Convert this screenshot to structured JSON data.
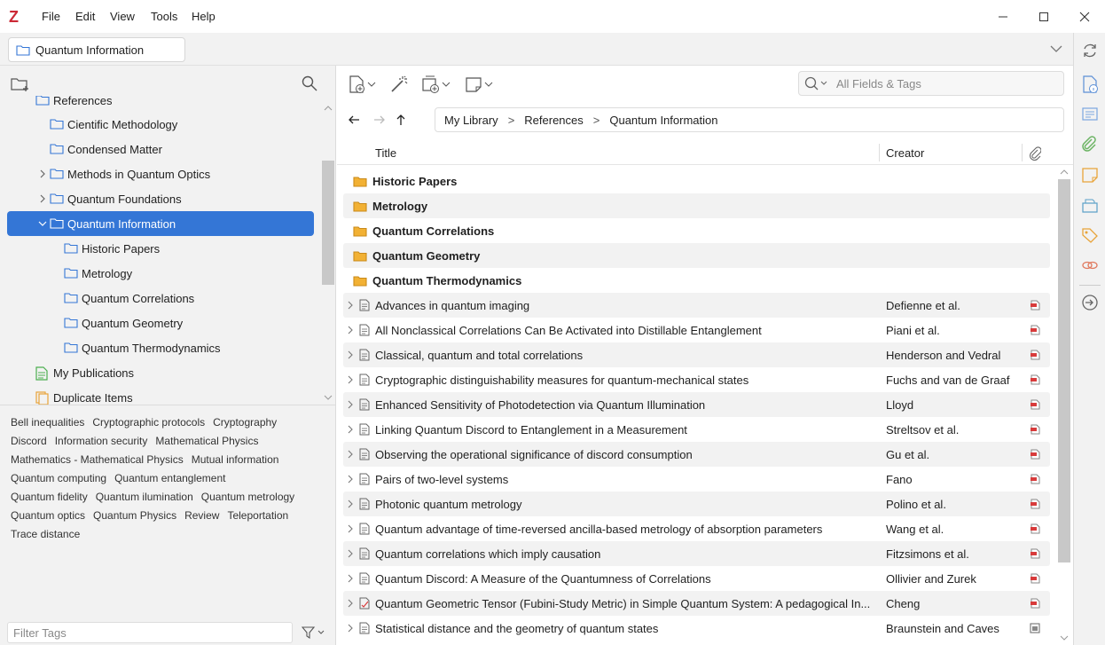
{
  "app": {
    "logo": "Z"
  },
  "menu": [
    "File",
    "Edit",
    "View",
    "Tools",
    "Help"
  ],
  "tab": {
    "label": "Quantum Information"
  },
  "collections": {
    "partial_top": "References",
    "items": [
      {
        "label": "Cientific Methodology",
        "level": 2,
        "expandable": false
      },
      {
        "label": "Condensed Matter",
        "level": 2,
        "expandable": false
      },
      {
        "label": "Methods in Quantum Optics",
        "level": 2,
        "expandable": true
      },
      {
        "label": "Quantum Foundations",
        "level": 2,
        "expandable": true
      },
      {
        "label": "Quantum Information",
        "level": 2,
        "expandable": true,
        "selected": true
      },
      {
        "label": "Historic Papers",
        "level": 3
      },
      {
        "label": "Metrology",
        "level": 3
      },
      {
        "label": "Quantum Correlations",
        "level": 3
      },
      {
        "label": "Quantum Geometry",
        "level": 3
      },
      {
        "label": "Quantum Thermodynamics",
        "level": 3
      },
      {
        "label": "My Publications",
        "level": 1,
        "type": "publications"
      },
      {
        "label": "Duplicate Items",
        "level": 1,
        "type": "duplicates"
      }
    ]
  },
  "tags": {
    "lines": [
      [
        "Bell inequalities",
        "Cryptographic protocols",
        "Cryptography"
      ],
      [
        "Discord",
        "Information security",
        "Mathematical Physics"
      ],
      [
        "Mathematics - Mathematical Physics",
        "Mutual information"
      ],
      [
        "Quantum computing",
        "Quantum entanglement"
      ],
      [
        "Quantum fidelity",
        "Quantum ilumination",
        "Quantum metrology"
      ],
      [
        "Quantum optics",
        "Quantum Physics",
        "Review",
        "Teleportation"
      ],
      [
        "Trace distance"
      ]
    ],
    "filter_placeholder": "Filter Tags"
  },
  "search": {
    "placeholder": "All Fields & Tags"
  },
  "breadcrumb": [
    "My Library",
    "References",
    "Quantum Information"
  ],
  "columns": {
    "title": "Title",
    "creator": "Creator"
  },
  "subcollections": [
    "Historic Papers",
    "Metrology",
    "Quantum Correlations",
    "Quantum Geometry",
    "Quantum Thermodynamics"
  ],
  "items": [
    {
      "title": "Advances in quantum imaging",
      "creator": "Defienne et al.",
      "att": "pdf"
    },
    {
      "title": "All Nonclassical Correlations Can Be Activated into Distillable Entanglement",
      "creator": "Piani et al.",
      "att": "pdf"
    },
    {
      "title": "Classical, quantum and total correlations",
      "creator": "Henderson and Vedral",
      "att": "pdf"
    },
    {
      "title": "Cryptographic distinguishability measures for quantum-mechanical states",
      "creator": "Fuchs and van de Graaf",
      "att": "pdf"
    },
    {
      "title": "Enhanced Sensitivity of Photodetection via Quantum Illumination",
      "creator": "Lloyd",
      "att": "pdf"
    },
    {
      "title": "Linking Quantum Discord to Entanglement in a Measurement",
      "creator": "Streltsov et al.",
      "att": "pdf"
    },
    {
      "title": "Observing the operational significance of discord consumption",
      "creator": "Gu et al.",
      "att": "pdf"
    },
    {
      "title": "Pairs of two-level systems",
      "creator": "Fano",
      "att": "pdf"
    },
    {
      "title": "Photonic quantum metrology",
      "creator": "Polino et al.",
      "att": "pdf"
    },
    {
      "title": "Quantum advantage of time-reversed ancilla-based metrology of absorption parameters",
      "creator": "Wang et al.",
      "att": "pdf"
    },
    {
      "title": "Quantum correlations which imply causation",
      "creator": "Fitzsimons et al.",
      "att": "pdf"
    },
    {
      "title": "Quantum Discord: A Measure of the Quantumness of Correlations",
      "creator": "Ollivier and Zurek",
      "att": "pdf"
    },
    {
      "title": "Quantum Geometric Tensor (Fubini-Study Metric) in Simple Quantum System: A pedagogical In...",
      "creator": "Cheng",
      "att": "pdf",
      "type": "thesis"
    },
    {
      "title": "Statistical distance and the geometry of quantum states",
      "creator": "Braunstein and Caves",
      "att": "snapshot"
    }
  ],
  "colors": {
    "accent": "#3476d6",
    "folder_yellow": "#f2b134",
    "pdf_red": "#d83b3b",
    "logo_red": "#cc2936"
  }
}
